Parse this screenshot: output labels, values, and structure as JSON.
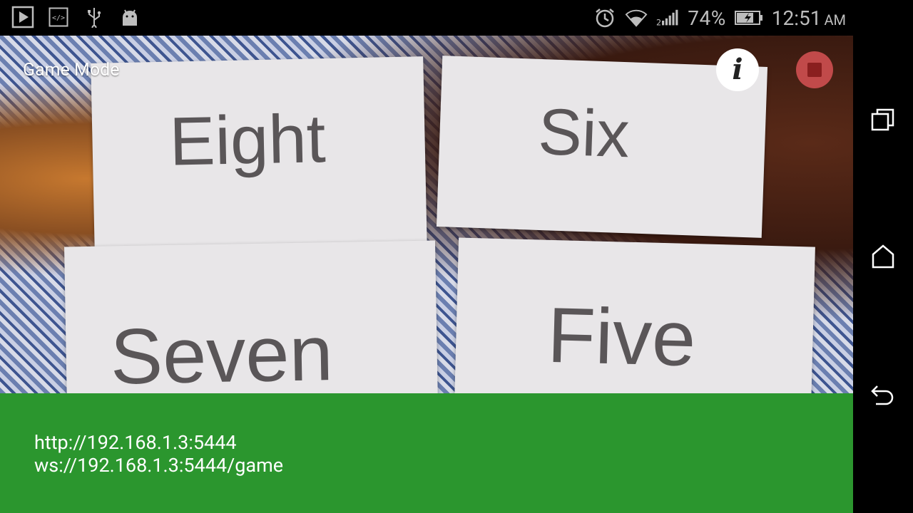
{
  "status_bar": {
    "left_icons": [
      "play-store-icon",
      "code-icon",
      "usb-icon",
      "android-icon"
    ],
    "right_icons": [
      "alarm-icon",
      "wifi-icon",
      "signal-icon",
      "battery-charging-icon"
    ],
    "battery": "74%",
    "time": "12:51",
    "ampm": "AM"
  },
  "camera": {
    "mode_label": "Game Mode",
    "cards": [
      "Eight",
      "Six",
      "Seven",
      "Five"
    ],
    "info_label": "i"
  },
  "panel": {
    "http_url": "http://192.168.1.3:5444",
    "ws_url": "ws://192.168.1.3:5444/game",
    "color": "#2b962e"
  },
  "nav_bar": {
    "buttons": [
      "recents-icon",
      "home-icon",
      "back-icon"
    ]
  }
}
